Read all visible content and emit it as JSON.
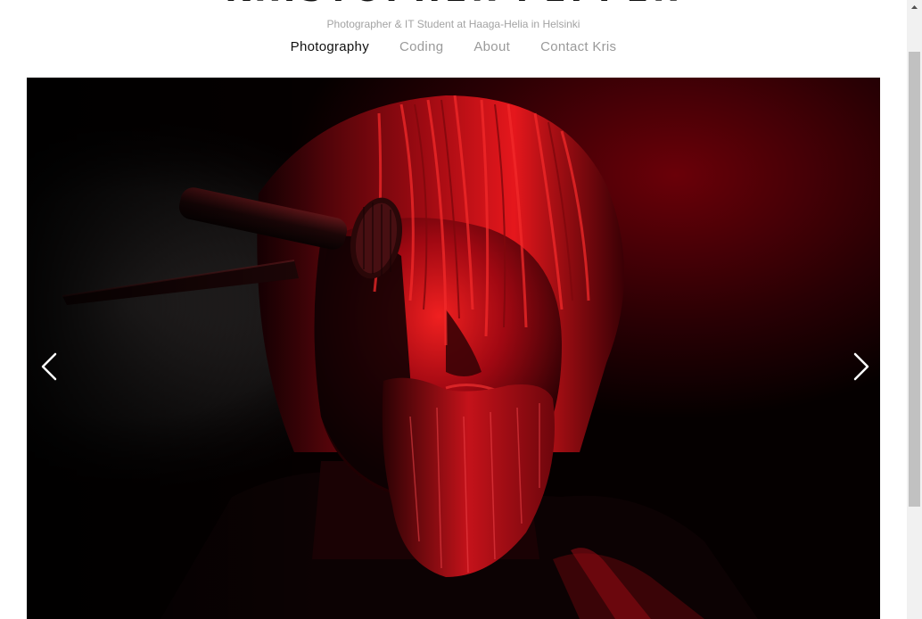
{
  "site": {
    "title": "KRISTOPHER PEPPER",
    "tagline": "Photographer & IT Student at Haaga-Helia in Helsinki"
  },
  "nav": {
    "items": [
      {
        "label": "Photography",
        "active": true
      },
      {
        "label": "Coding",
        "active": false
      },
      {
        "label": "About",
        "active": false
      },
      {
        "label": "Contact Kris",
        "active": false
      }
    ]
  },
  "slideshow": {
    "prev_icon": "chevron-left-icon",
    "next_icon": "chevron-right-icon"
  },
  "colors": {
    "title": "#111111",
    "tagline": "#a3a3a3",
    "nav_inactive": "#9a9a9a",
    "nav_active": "#111111",
    "photo_accent": "#d0101a"
  }
}
